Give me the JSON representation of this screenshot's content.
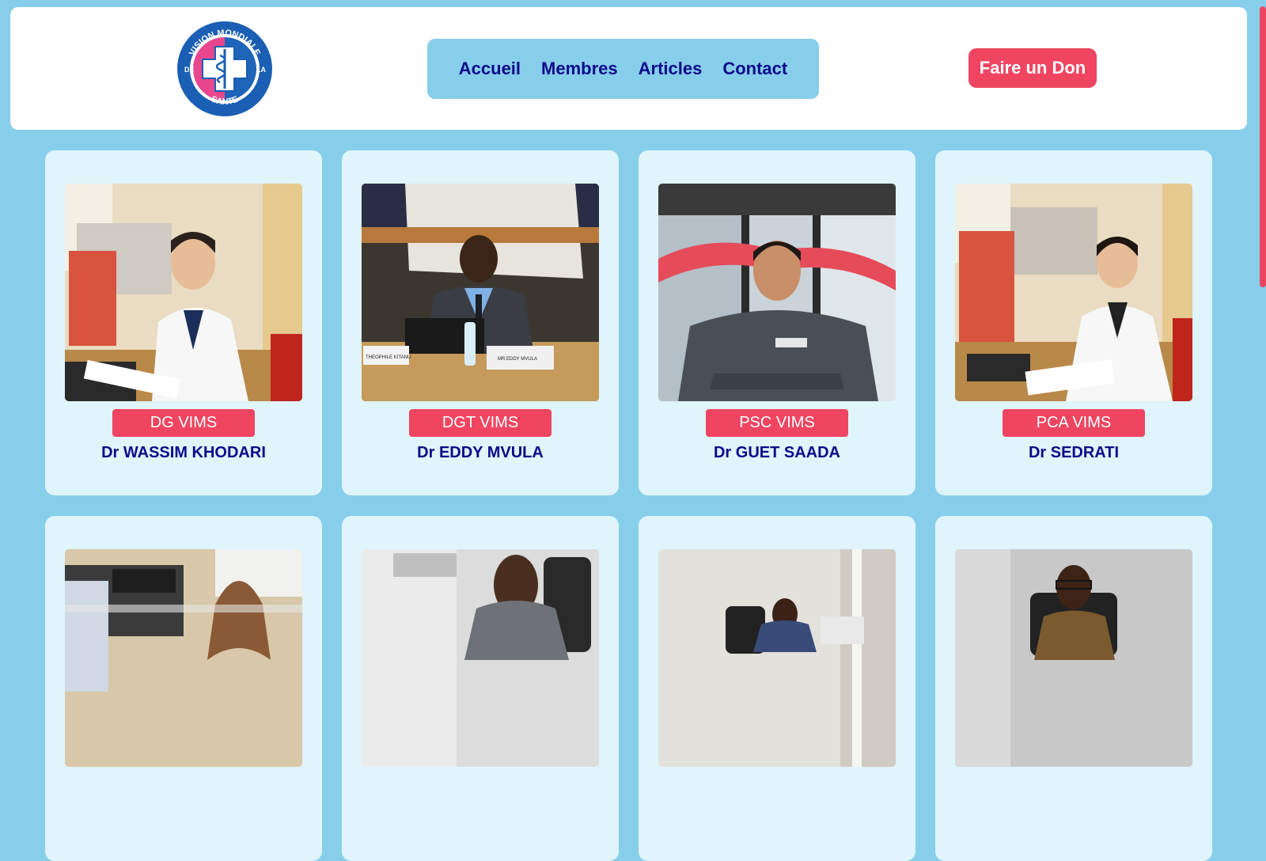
{
  "logo": {
    "top_text": "VISION MONDIALE",
    "left_text": "DE",
    "right_text": "LA",
    "bottom_text": "SANTE"
  },
  "nav": {
    "items": [
      "Accueil",
      "Membres",
      "Articles",
      "Contact"
    ]
  },
  "donate_label": "Faire un Don",
  "members": [
    {
      "role": "DG VIMS",
      "name": "Dr WASSIM KHODARI",
      "photo_labels": []
    },
    {
      "role": "DGT VIMS",
      "name": "Dr EDDY MVULA",
      "photo_labels": [
        "THEOPHILE KITANU",
        "MR.EDDY MVULA"
      ]
    },
    {
      "role": "PSC VIMS",
      "name": "Dr GUET SAADA",
      "photo_labels": []
    },
    {
      "role": "PCA VIMS",
      "name": "Dr SEDRATI",
      "photo_labels": []
    },
    {
      "role": "",
      "name": "",
      "photo_labels": []
    },
    {
      "role": "",
      "name": "",
      "photo_labels": []
    },
    {
      "role": "",
      "name": "",
      "photo_labels": []
    },
    {
      "role": "",
      "name": "",
      "photo_labels": []
    }
  ],
  "colors": {
    "page_bg": "#87ceeb",
    "accent": "#ef4561",
    "text_dark_blue": "#0a0a8a",
    "card_bg": "#dff4fb"
  }
}
